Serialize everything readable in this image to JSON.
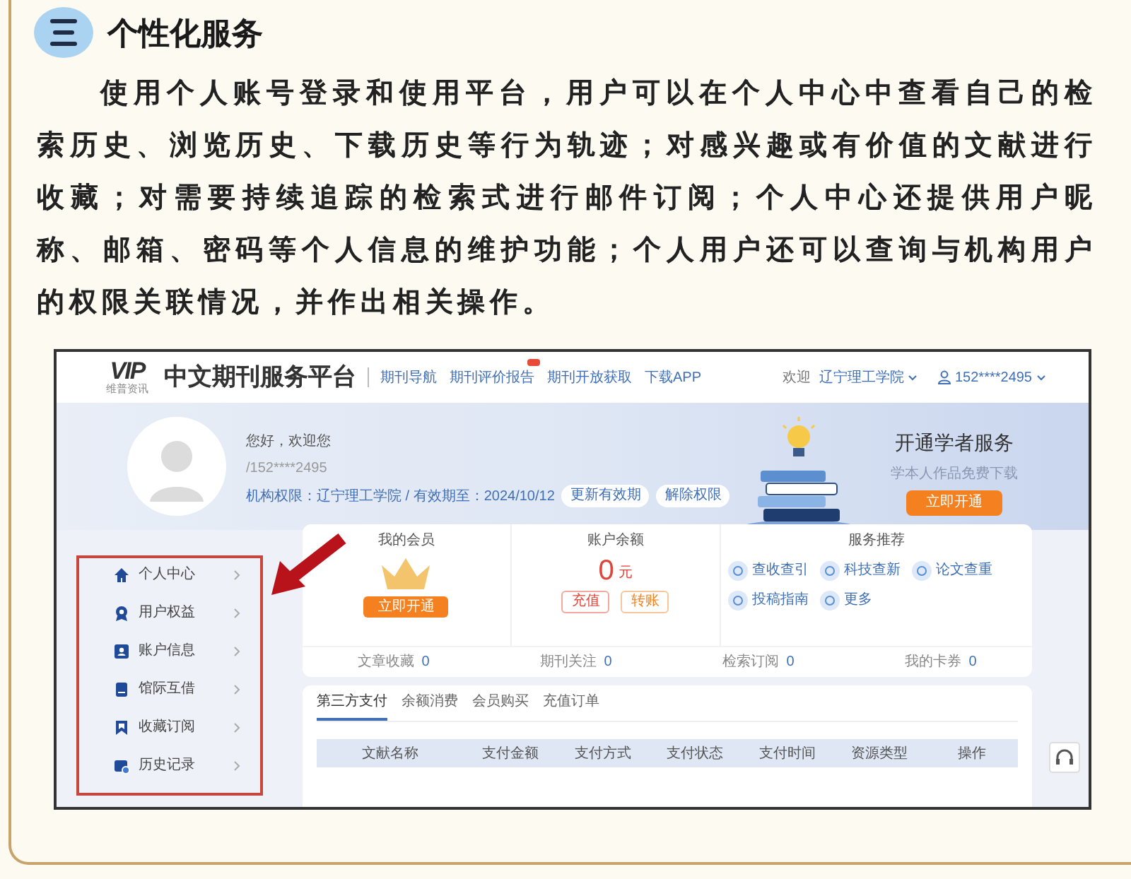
{
  "heading": "个性化服务",
  "paragraph": "使用个人账号登录和使用平台，用户可以在个人中心中查看自己的检索历史、浏览历史、下载历史等行为轨迹；对感兴趣或有价值的文献进行收藏；对需要持续追踪的检索式进行邮件订阅；个人中心还提供用户昵称、邮箱、密码等个人信息的维护功能；个人用户还可以查询与机构用户的权限关联情况，并作出相关操作。",
  "screenshot": {
    "nav": {
      "logo_mark": "VIP",
      "logo_sub": "维普资讯",
      "title": "中文期刊服务平台",
      "links": [
        "期刊导航",
        "期刊评价报告",
        "期刊开放获取",
        "下载APP"
      ],
      "welcome": "欢迎",
      "institution": "辽宁理工学院",
      "user": "152****2495"
    },
    "banner": {
      "greeting": "您好，欢迎您",
      "account": "/152****2495",
      "permission": "机构权限：辽宁理工学院 / 有效期至：2024/10/12",
      "buttons": [
        "更新有效期",
        "解除权限"
      ],
      "promo_title": "开通学者服务",
      "promo_subtitle": "学本人作品免费下载",
      "promo_button": "立即开通"
    },
    "sidebar": [
      {
        "label": "个人中心"
      },
      {
        "label": "用户权益"
      },
      {
        "label": "账户信息"
      },
      {
        "label": "馆际互借"
      },
      {
        "label": "收藏订阅"
      },
      {
        "label": "历史记录"
      }
    ],
    "membership": {
      "title": "我的会员",
      "button": "立即开通"
    },
    "balance": {
      "title": "账户余额",
      "amount": "0",
      "unit": "元",
      "buttons": [
        "充值",
        "转账"
      ]
    },
    "services": {
      "title": "服务推荐",
      "items": [
        "查收查引",
        "科技查新",
        "论文查重",
        "投稿指南",
        "更多"
      ]
    },
    "stats": [
      {
        "label": "文章收藏",
        "value": "0"
      },
      {
        "label": "期刊关注",
        "value": "0"
      },
      {
        "label": "检索订阅",
        "value": "0"
      },
      {
        "label": "我的卡券",
        "value": "0"
      }
    ],
    "tabs": [
      {
        "label": "第三方支付",
        "selected": true
      },
      {
        "label": "余额消费",
        "selected": false
      },
      {
        "label": "会员购买",
        "selected": false
      },
      {
        "label": "充值订单",
        "selected": false
      }
    ],
    "table": {
      "columns": [
        "文献名称",
        "支付金额",
        "支付方式",
        "支付状态",
        "支付时间",
        "资源类型",
        "操作"
      ]
    }
  }
}
